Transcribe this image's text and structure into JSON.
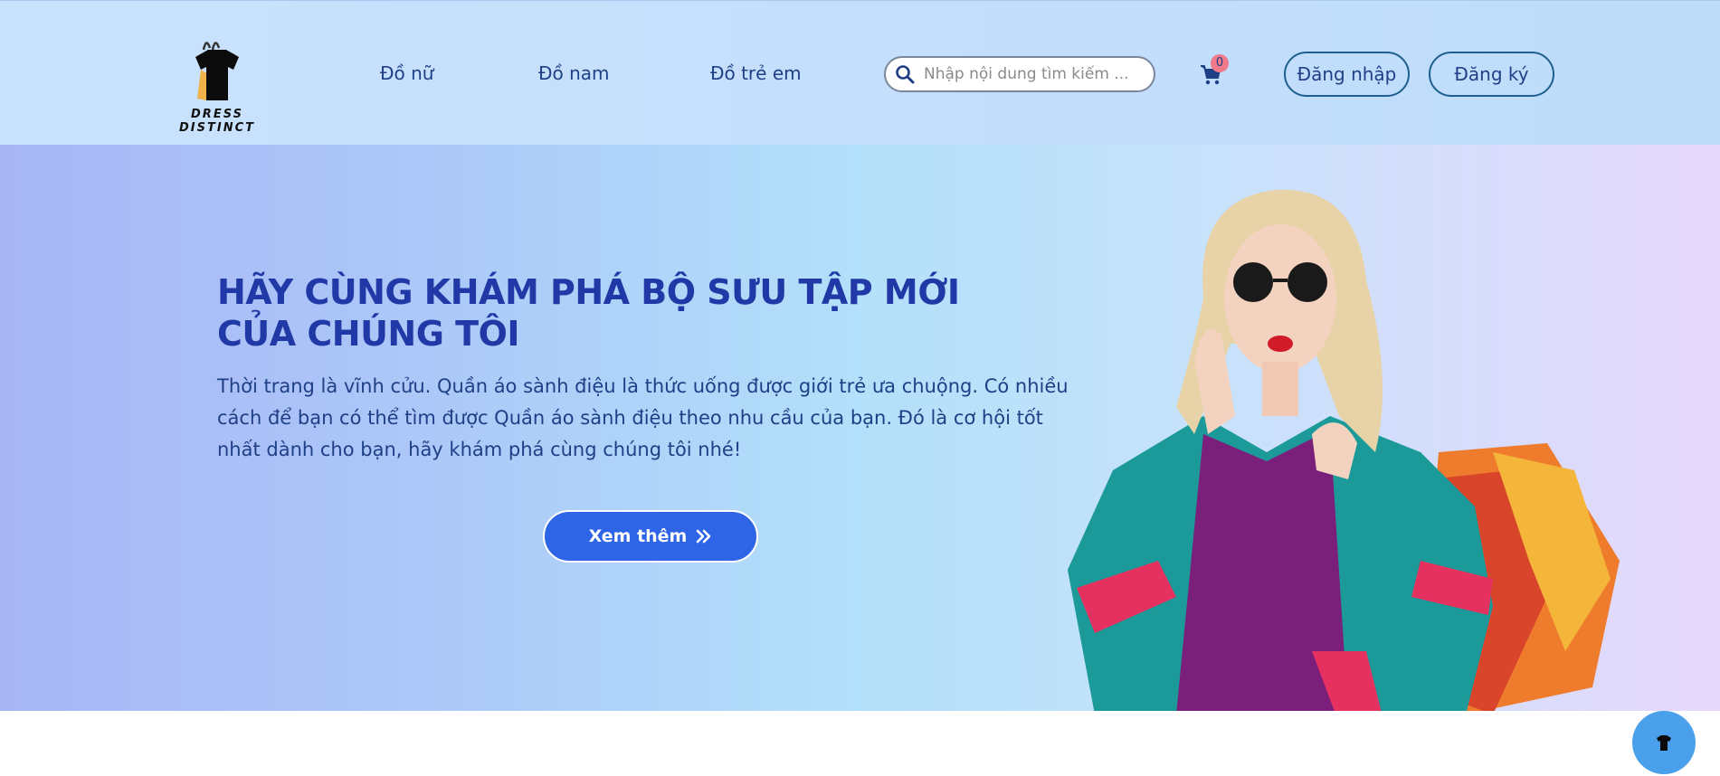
{
  "header": {
    "logo_text": "DRESS DISTINCT",
    "nav": [
      "Đồ nữ",
      "Đồ nam",
      "Đồ trẻ em"
    ],
    "search_placeholder": "Nhập nội dung tìm kiếm ...",
    "cart_count": "0",
    "login_label": "Đăng nhập",
    "register_label": "Đăng ký"
  },
  "hero": {
    "title": "HÃY CÙNG KHÁM PHÁ BỘ SƯU TẬP MỚI CỦA CHÚNG TÔI",
    "description": "Thời trang là vĩnh cửu. Quần áo sành điệu là thức uống được giới trẻ ưa chuộng. Có nhiều cách để bạn có thể tìm được Quần áo sành điệu theo nhu cầu của bạn. Đó là cơ hội tốt nhất dành cho bạn, hãy khám phá cùng chúng tôi nhé!",
    "cta_label": "Xem thêm"
  },
  "colors": {
    "primary": "#2e64e6",
    "heading": "#2139a6",
    "text": "#1f3f86",
    "badge": "#f07a8a"
  },
  "icons": {
    "search": "search-icon",
    "cart": "cart-icon",
    "cta": "double-chevron-right-icon",
    "float": "logo-icon"
  }
}
